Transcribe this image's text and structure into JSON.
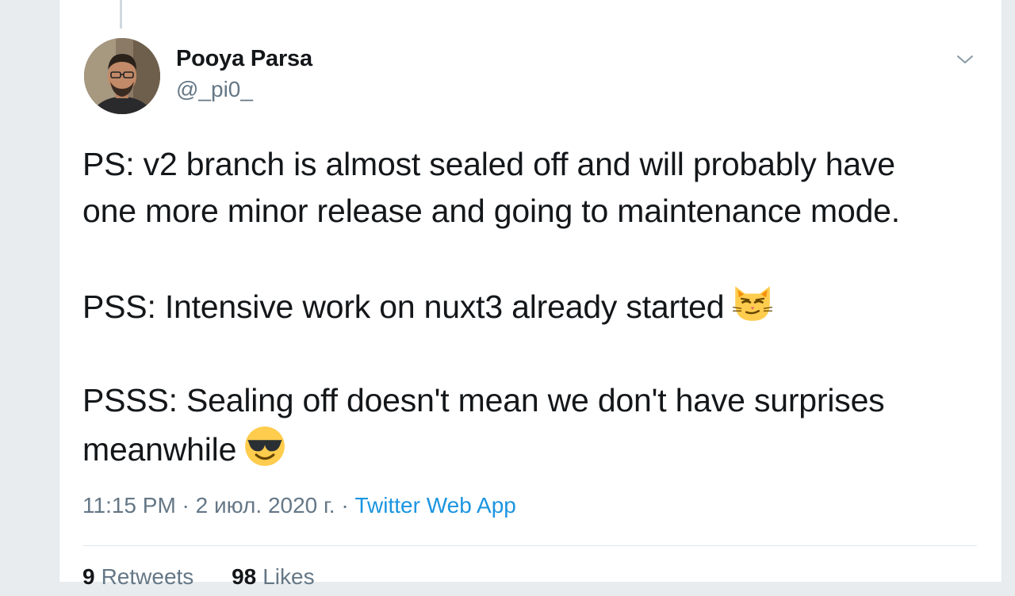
{
  "author": {
    "name": "Pooya Parsa",
    "handle": "@_pi0_"
  },
  "tweet": {
    "paragraphs": [
      {
        "lines": [
          "PS: v2 branch is almost sealed off and will probably have",
          "one more minor release and going to maintenance mode."
        ]
      },
      {
        "lines": [
          "PSS: Intensive work on nuxt3 already started"
        ],
        "emoji": "smirking-cat-face"
      },
      {
        "lines": [
          "PSSS: Sealing off doesn't mean we don't have surprises",
          "meanwhile"
        ],
        "emoji": "smiling-face-with-sunglasses"
      }
    ],
    "p1_line1": "PS: v2 branch is almost sealed off and will probably have",
    "p1_line2": "one more minor release and going to maintenance mode.",
    "p2_line1": "PSS: Intensive work on nuxt3 already started",
    "p3_line1": "PSSS: Sealing off doesn't mean we don't have surprises",
    "p3_line2": "meanwhile"
  },
  "meta": {
    "time": "11:15 PM",
    "separator": " · ",
    "date": "2 июл. 2020 г.",
    "source": "Twitter Web App"
  },
  "stats": {
    "retweets_count": "9",
    "retweets_label": "Retweets",
    "likes_count": "98",
    "likes_label": "Likes"
  },
  "icons": {
    "caret": "chevron-down-icon",
    "emoji_cat": "smirking-cat-face",
    "emoji_sunglasses": "smiling-face-with-sunglasses"
  },
  "colors": {
    "text_primary": "#14171a",
    "text_secondary": "#657786",
    "link": "#1b95e0",
    "divider": "#e1e8ed"
  }
}
